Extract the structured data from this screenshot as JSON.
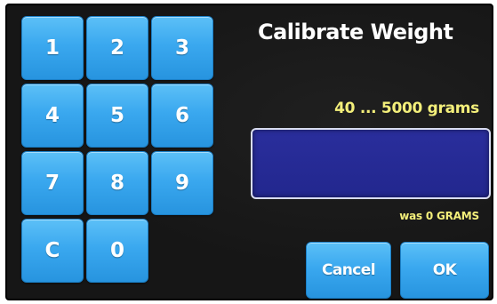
{
  "dialog": {
    "title": "Calibrate Weight",
    "range_hint": "40 ... 5000 grams",
    "entry_value": "",
    "previous_value": "was 0 GRAMS"
  },
  "keypad": {
    "keys": [
      "1",
      "2",
      "3",
      "4",
      "5",
      "6",
      "7",
      "8",
      "9",
      "C",
      "0"
    ]
  },
  "actions": {
    "cancel_label": "Cancel",
    "ok_label": "OK"
  },
  "colors": {
    "background": "#161616",
    "key_blue": "#3aa8ef",
    "entry_blue": "#24298f",
    "hint_yellow": "#f3ef7a"
  }
}
